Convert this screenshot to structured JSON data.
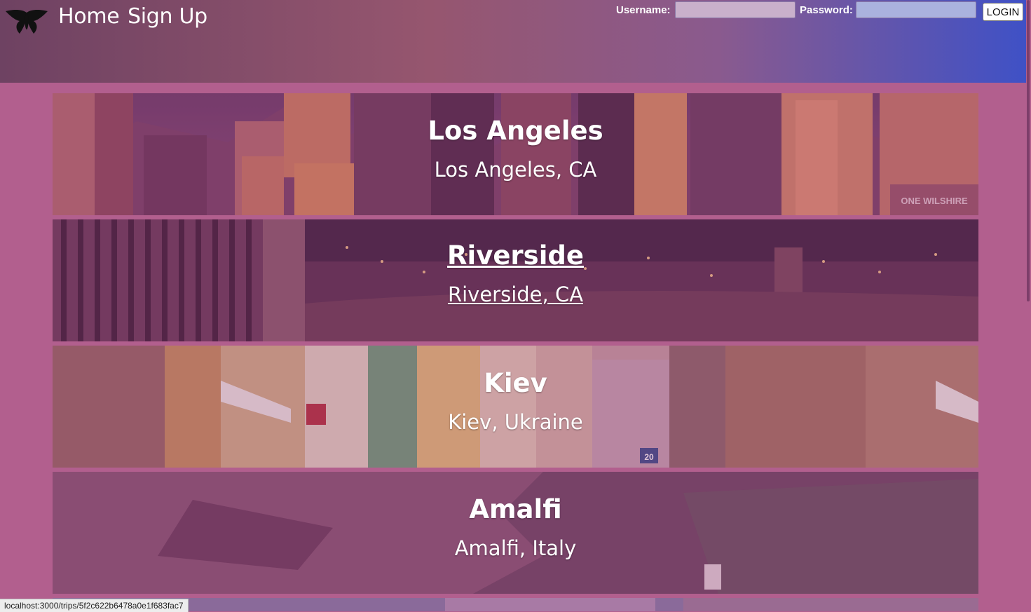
{
  "nav": {
    "home_label": "Home",
    "signup_label": "Sign Up"
  },
  "login": {
    "username_label": "Username:",
    "username_value": "",
    "password_label": "Password:",
    "password_value": "",
    "button_label": "LOGIN"
  },
  "trips": [
    {
      "title": "Los Angeles",
      "location": "Los Angeles, CA",
      "image_sign": "ONE WILSHIRE"
    },
    {
      "title": "Riverside",
      "location": "Riverside, CA"
    },
    {
      "title": "Kiev",
      "location": "Kiev, Ukraine",
      "image_sign": "20"
    },
    {
      "title": "Amalfi",
      "location": "Amalfi, Italy"
    }
  ],
  "status_bar": {
    "url": "localhost:3000/trips/5f2c622b6478a0e1f683fac7"
  },
  "colors": {
    "page_background": "#b25f8e",
    "header_gradient_start": "#6e4262",
    "header_gradient_end": "#3f51c6"
  }
}
